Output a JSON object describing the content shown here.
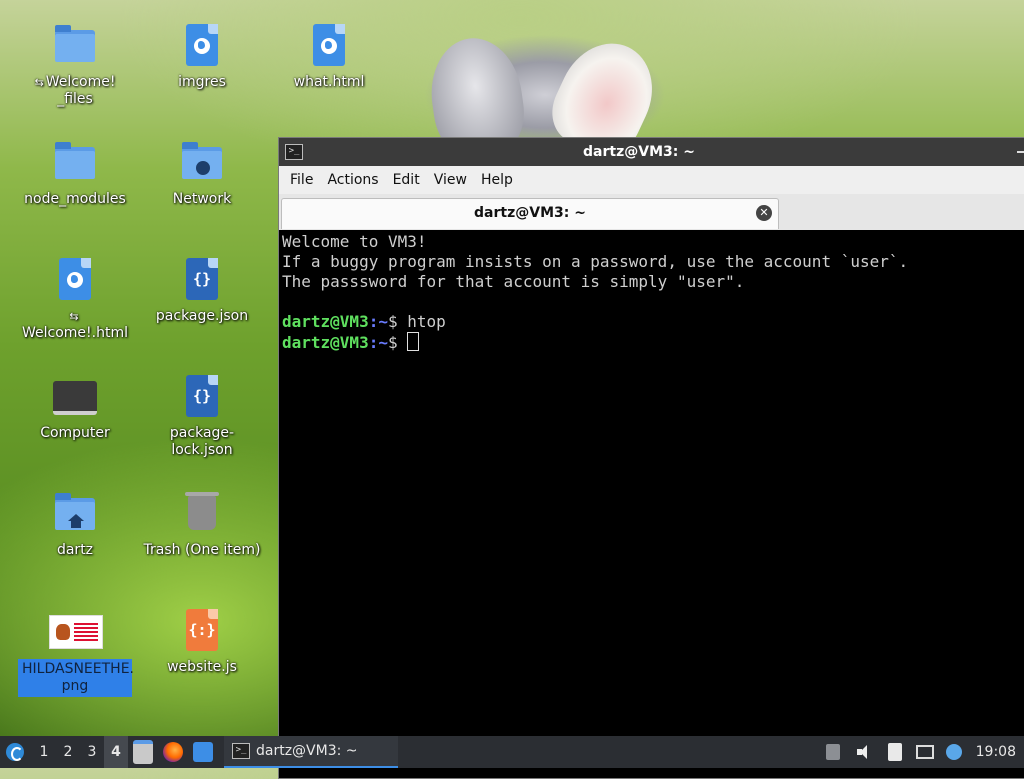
{
  "desktop": {
    "icons": [
      {
        "label": "Welcome!\n_files",
        "symlink": true
      },
      {
        "label": "imgres"
      },
      {
        "label": "what.html"
      },
      {
        "label": "node_modules"
      },
      {
        "label": "Network"
      },
      {
        "label": "Welcome!.html",
        "symlink": true
      },
      {
        "label": "package.json"
      },
      {
        "label": "Computer"
      },
      {
        "label": "package-\nlock.json"
      },
      {
        "label": "dartz"
      },
      {
        "label": "Trash (One item)"
      },
      {
        "label": "HILDASNEETHE.\npng",
        "selected": true
      },
      {
        "label": "website.js"
      }
    ]
  },
  "terminal": {
    "window_title": "dartz@VM3: ~",
    "menu": [
      "File",
      "Actions",
      "Edit",
      "View",
      "Help"
    ],
    "tab_label": "dartz@VM3: ~",
    "output": [
      "Welcome to VM3!",
      "If a buggy program insists on a password, use the account `user`.",
      "The passsword for that account is simply \"user\"."
    ],
    "prompt_user": "dartz@VM3",
    "prompt_path": ":~",
    "prompt_symbol": "$",
    "history_command": " htop"
  },
  "taskbar": {
    "workspaces": [
      "1",
      "2",
      "3",
      "4"
    ],
    "active_workspace": "4",
    "task_label": "dartz@VM3: ~",
    "clock": "19:08"
  },
  "colors": {
    "prompt_user": "#5fe05f",
    "prompt_path": "#6a7cff",
    "accent": "#3d8ee6"
  }
}
